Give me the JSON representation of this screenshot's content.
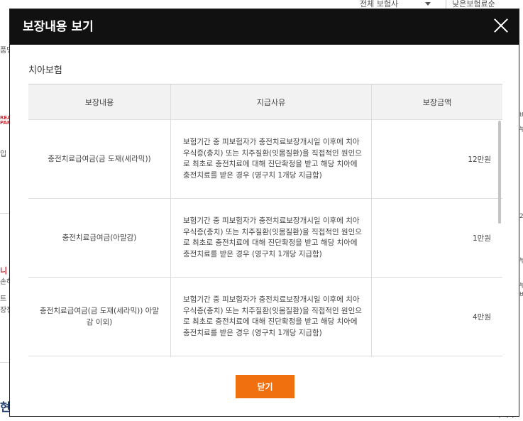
{
  "background": {
    "filter_all_insurers": "전체 보험사",
    "filter_sort": "낮은보험료순",
    "left_snippets": [
      "품명",
      "입",
      "손해",
      "트 처",
      "장정"
    ],
    "logo_text": "REAL L\nPANY",
    "logo2_text": "니 ㅌ",
    "big_text": "현다",
    "right_snippets": [
      "비",
      "부",
      "2",
      "부",
      "부",
      "비",
      "부여가"
    ]
  },
  "modal": {
    "title": "보장내용 보기",
    "section_title": "치아보험",
    "table": {
      "headers": [
        "보장내용",
        "지급사유",
        "보장금액"
      ],
      "rows": [
        {
          "coverage": "충전치료급여금(금 도재(세라믹))",
          "reason": "보험기간 중 피보험자가 충전치료보장개시일 이후에 치아우식증(충치) 또는 치주질환(잇몸질환)을 직접적인 원인으로 최초로 충전치료에 대해 진단확정을 받고 해당 치아에 충전치료를 받은 경우 (영구치 1개당 지급함)",
          "amount": "12만원"
        },
        {
          "coverage": "충전치료급여금(아말감)",
          "reason": "보험기간 중 피보험자가 충전치료보장개시일 이후에 치아우식증(충치) 또는 치주질환(잇몸질환)을 직접적인 원인으로 최초로 충전치료에 대해 진단확정을 받고 해당 치아에 충전치료를 받은 경우 (영구치 1개당 지급함)",
          "amount": "1만원"
        },
        {
          "coverage": "충전치료급여금(금 도재(세라믹)) 아말감 이외)",
          "reason": "보험기간 중 피보험자가 충전치료보장개시일 이후에 치아우식증(충치) 또는 치주질환(잇몸질환)을 직접적인 원인으로 최초로 충전치료에 대해 진단확정을 받고 해당 치아에 충전치료를 받은 경우 (영구치 1개당 지급함)",
          "amount": "4만원"
        },
        {
          "coverage": "",
          "reason": "",
          "amount": ""
        }
      ]
    },
    "confirm_label": "닫기"
  }
}
